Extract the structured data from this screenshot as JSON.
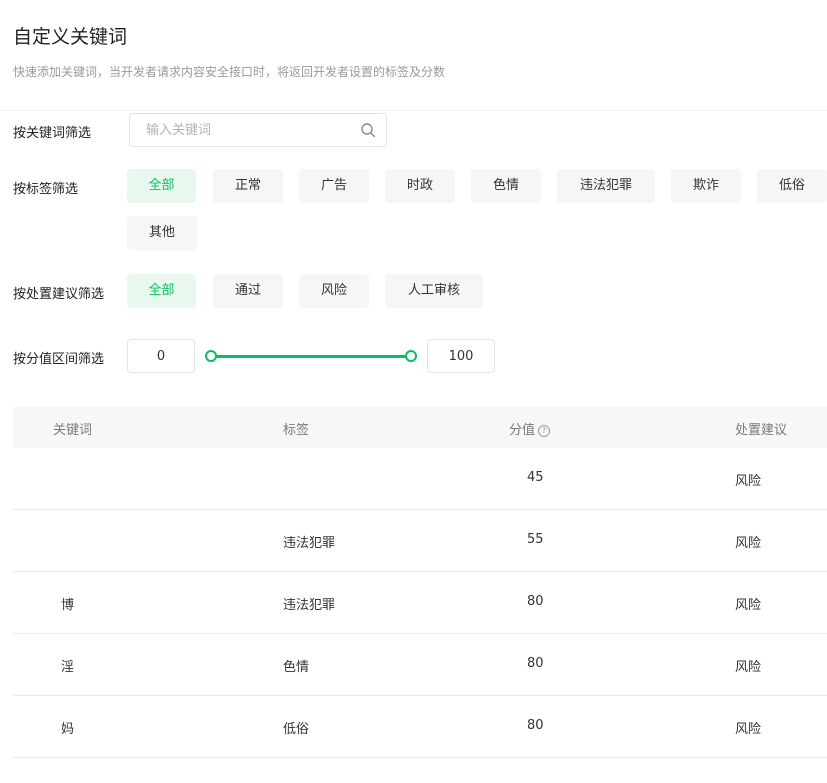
{
  "header": {
    "title": "自定义关键词",
    "subtitle": "快速添加关键词，当开发者请求内容安全接口时，将返回开发者设置的标签及分数"
  },
  "filters": {
    "keyword": {
      "label": "按关键词筛选",
      "placeholder": "输入关键词",
      "value": ""
    },
    "tag": {
      "label": "按标签筛选",
      "options": [
        "全部",
        "正常",
        "广告",
        "时政",
        "色情",
        "违法犯罪",
        "欺诈",
        "低俗",
        "其他"
      ],
      "selected": "全部"
    },
    "suggestion": {
      "label": "按处置建议筛选",
      "options": [
        "全部",
        "通过",
        "风险",
        "人工审核"
      ],
      "selected": "全部"
    },
    "score": {
      "label": "按分值区间筛选",
      "min": "0",
      "max": "100"
    }
  },
  "table": {
    "headers": [
      "关键词",
      "标签",
      "分值",
      "处置建议"
    ],
    "rows": [
      {
        "keyword": "",
        "tag": "",
        "score": "45",
        "suggestion": "风险"
      },
      {
        "keyword": "",
        "tag": "违法犯罪",
        "score": "55",
        "suggestion": "风险"
      },
      {
        "keyword": "博",
        "tag": "违法犯罪",
        "score": "80",
        "suggestion": "风险"
      },
      {
        "keyword": "淫",
        "tag": "色情",
        "score": "80",
        "suggestion": "风险"
      },
      {
        "keyword": "妈",
        "tag": "低俗",
        "score": "80",
        "suggestion": "风险"
      }
    ]
  },
  "icons": {
    "search": "search-icon",
    "help": "question-circle-icon"
  },
  "colors": {
    "accent": "#07c160",
    "accent_bg": "#e8f8ef",
    "chip_bg": "#f6f6f6",
    "header_bg": "#f7f7f7"
  }
}
